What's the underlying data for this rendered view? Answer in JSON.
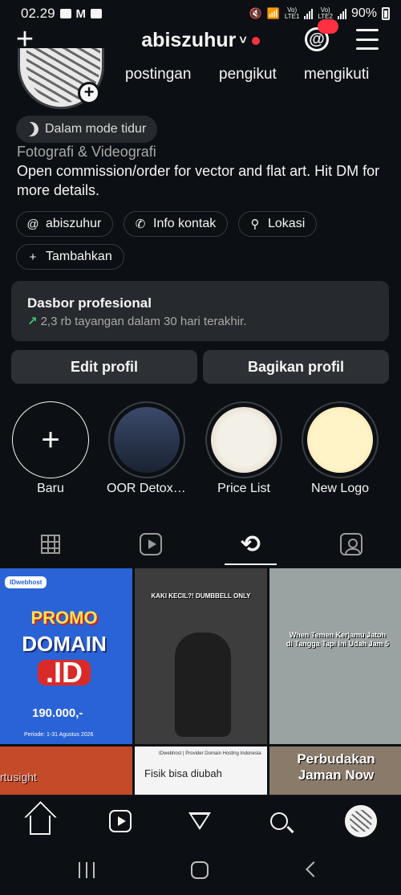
{
  "status_bar": {
    "time": "02.29",
    "battery": "90%",
    "lte1": "Vo)\nLTE1",
    "lte2": "Vo)\nLTE2"
  },
  "top_bar": {
    "username": "abiszuhur",
    "chevron": "˅"
  },
  "profile": {
    "stats": {
      "posts_label": "postingan",
      "followers_label": "pengikut",
      "following_label": "mengikuti"
    },
    "sleep_mode": "Dalam mode tidur",
    "category": "Fotografi & Videografi",
    "bio": "Open commission/order for vector and flat art. Hit DM for more details.",
    "chips": {
      "threads": "abiszuhur",
      "contact": "Info kontak",
      "location": "Lokasi",
      "add": "Tambahkan"
    }
  },
  "dashboard": {
    "title": "Dasbor profesional",
    "subtitle": "2,3 rb tayangan dalam 30 hari terakhir."
  },
  "buttons": {
    "edit": "Edit profil",
    "share": "Bagikan profil"
  },
  "highlights": [
    {
      "label": "Baru"
    },
    {
      "label": "OOR Detox JK..."
    },
    {
      "label": "Price List"
    },
    {
      "label": "New Logo"
    }
  ],
  "posts": {
    "p1": {
      "brand": "IDwebhost",
      "promo": "PROMO",
      "domain": "DOMAIN",
      "id": ".ID",
      "price": "190.000,-",
      "period": "Periode: 1-31 Agustus 2026"
    },
    "p2": {
      "caption": "KAKI KECIL?! DUMBBELL ONLY"
    },
    "p3": {
      "caption": "When Temen Kerjamu Jatoh di Tangga Tapi Ini Udah Jam 5"
    },
    "p4": {
      "caption": "rtusight"
    },
    "p5": {
      "header": "IDwebhost | Provider Domain Hosting Indonesia",
      "caption": "Fisik bisa diubah"
    },
    "p6": {
      "caption": "Perbudakan Jaman Now"
    }
  },
  "colors": {
    "background": "#0c1014",
    "surface": "#262a2e",
    "accent_red": "#ff3040",
    "trend_green": "#3ec46d"
  }
}
